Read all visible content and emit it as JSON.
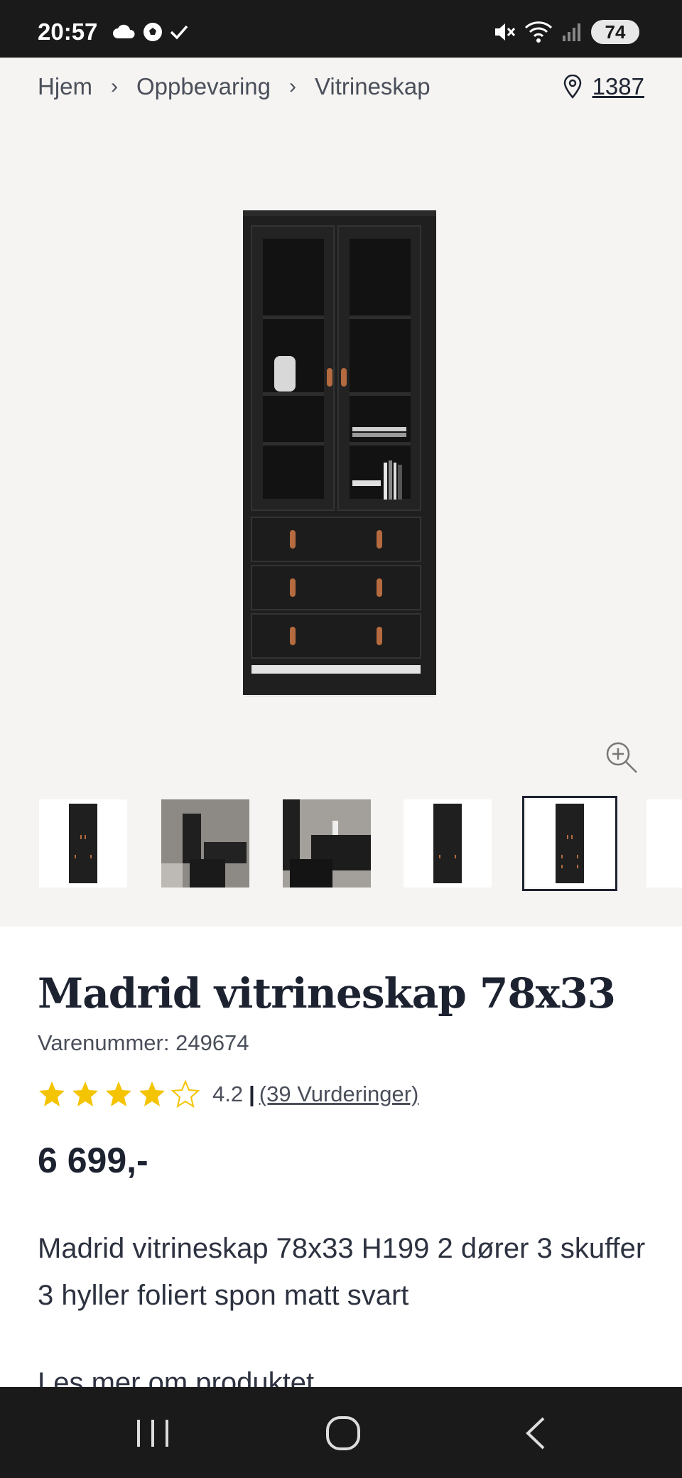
{
  "status_bar": {
    "time": "20:57",
    "battery": "74"
  },
  "breadcrumb": {
    "items": [
      "Hjem",
      "Oppbevaring",
      "Vitrineskap"
    ],
    "separator": "›"
  },
  "store": {
    "number": "1387"
  },
  "product": {
    "title": "Madrid vitrineskap 78x33",
    "sku": "Varenummer: 249674",
    "rating_value": "4.2",
    "rating_bar": "|",
    "reviews_link": "(39 Vurderinger)",
    "stars_filled": 4,
    "stars_total": 5,
    "price": "6 699,-",
    "description": "Madrid vitrineskap 78x33 H199 2 dører 3 skuffer 3 hyller foliert spon matt svart",
    "partial_text": "Les mer om produktet"
  },
  "thumbnails": {
    "selected_index": 4,
    "count": 6
  },
  "colors": {
    "star": "#f5c400",
    "text_dark": "#1d2230",
    "background": "#f5f4f2",
    "cabinet": "#1f1f1f",
    "handle": "#b56a3f"
  },
  "icons": {
    "location": "location-pin-icon",
    "zoom": "zoom-in-icon",
    "nav_recent": "recent-apps-icon",
    "nav_home": "home-icon",
    "nav_back": "back-icon"
  }
}
